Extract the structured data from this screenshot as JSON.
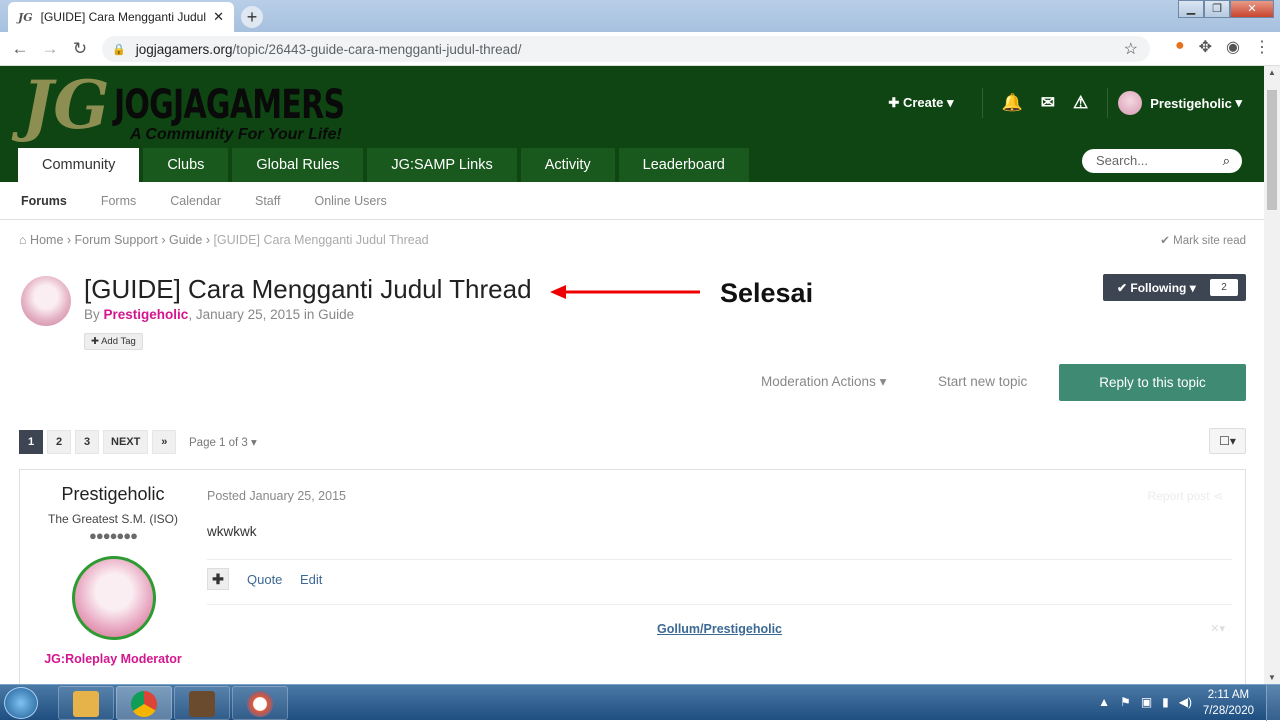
{
  "browser": {
    "tab_favicon": "JG",
    "tab_title": "[GUIDE] Cara Mengganti Judul Th",
    "tab_close": "✕",
    "new_tab": "+",
    "url_domain": "jogjagamers.org",
    "url_path": "/topic/26443-guide-cara-mengganti-judul-thread/"
  },
  "site": {
    "logo_mark": "JG",
    "logo_name": "JOGJAGAMERS",
    "logo_tagline": "A Community For Your Life!",
    "create_label": "Create",
    "username": "Prestigeholic",
    "nav_tabs": [
      "Community",
      "Clubs",
      "Global Rules",
      "JG:SAMP Links",
      "Activity",
      "Leaderboard"
    ],
    "search_placeholder": "Search...",
    "subnav": [
      "Forums",
      "Forms",
      "Calendar",
      "Staff",
      "Online Users"
    ]
  },
  "breadcrumb": {
    "home": "Home",
    "items": [
      "Forum Support",
      "Guide"
    ],
    "current": "[GUIDE] Cara Mengganti Judul Thread",
    "mark_read": "Mark site read"
  },
  "topic": {
    "title": "[GUIDE] Cara Mengganti Judul Thread",
    "annotation": "Selesai",
    "by_prefix": "By",
    "author": "Prestigeholic",
    "meta_suffix": ", January 25, 2015 in Guide",
    "add_tag": "Add Tag",
    "following_label": "Following",
    "following_count": "2",
    "moderation_actions": "Moderation Actions",
    "start_new_topic": "Start new topic",
    "reply_label": "Reply to this topic"
  },
  "pagination": {
    "pages": [
      "1",
      "2",
      "3"
    ],
    "next_label": "NEXT",
    "last_label": "»",
    "page_of": "Page 1 of 3"
  },
  "post": {
    "author_name": "Prestigeholic",
    "rank_title": "The Greatest S.M. (ISO)",
    "pips": "●●●●●●●",
    "group": "JG:Roleplay Moderator",
    "posted": "Posted January 25, 2015",
    "report": "Report post",
    "body": "wkwkwk",
    "quote_label": "Quote",
    "edit_label": "Edit",
    "signature": "Gollum/Prestigeholic"
  },
  "taskbar": {
    "time": "2:11 AM",
    "date": "7/28/2020"
  },
  "colors": {
    "header_bg": "#0e4512",
    "tab_bg": "#19591d",
    "author_pink": "#d3168f",
    "reply_green": "#3f8a72",
    "following_bg": "#3d4553"
  }
}
